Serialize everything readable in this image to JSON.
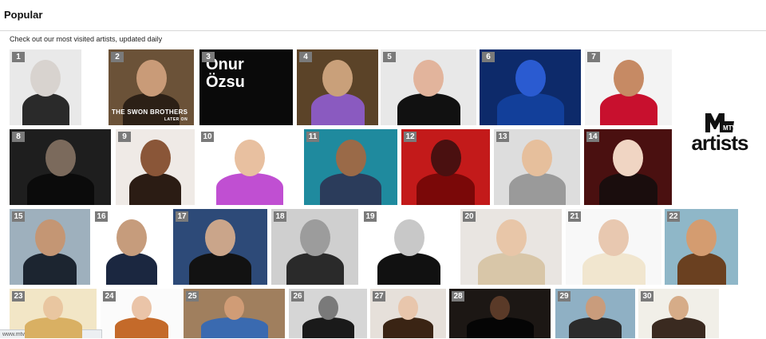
{
  "header": {
    "title": "Popular"
  },
  "subtitle": "Check out our most visited artists, updated daily",
  "brand": {
    "logo_text": "MTV",
    "word": "artists"
  },
  "status_bar": {
    "url": "www.mtv.com/artists/onur-ozsu/"
  },
  "tile_captions": {
    "onur": [
      "Onur",
      "Özsu"
    ],
    "swon": "THE SWON BROTHERS",
    "swon_sub": "LATER ON"
  },
  "artists": [
    {
      "rank": "1",
      "bg": "#e9e9e9",
      "figure": "#2a2a2a",
      "skin": "#d8d3cf"
    },
    {
      "rank": "2",
      "bg": "#6b5238",
      "figure": "#2c2016",
      "skin": "#c99b78"
    },
    {
      "rank": "3",
      "bg": "#0a0a0a",
      "figure": "#1b1b1b",
      "skin": "#1b1b1b"
    },
    {
      "rank": "4",
      "bg": "#5b4328",
      "figure": "#8a5ac0",
      "skin": "#c9a07a"
    },
    {
      "rank": "5",
      "bg": "#e8e8e8",
      "figure": "#111111",
      "skin": "#e2b49c"
    },
    {
      "rank": "6",
      "bg": "#0d2a6a",
      "figure": "#123f9a",
      "skin": "#2a5bd1"
    },
    {
      "rank": "7",
      "bg": "#f3f3f3",
      "figure": "#c8102e",
      "skin": "#c68a64"
    },
    {
      "rank": "8",
      "bg": "#1e1e1e",
      "figure": "#0b0b0b",
      "skin": "#7b6a5c"
    },
    {
      "rank": "9",
      "bg": "#efeae6",
      "figure": "#2b1c14",
      "skin": "#8a5638"
    },
    {
      "rank": "10",
      "bg": "#ffffff",
      "figure": "#c04fd2",
      "skin": "#e8c0a0"
    },
    {
      "rank": "11",
      "bg": "#1f8a9e",
      "figure": "#2b3c5b",
      "skin": "#9a6a48"
    },
    {
      "rank": "12",
      "bg": "#c31a1a",
      "figure": "#7a0808",
      "skin": "#4a1010"
    },
    {
      "rank": "13",
      "bg": "#dddddd",
      "figure": "#9a9a9a",
      "skin": "#e6bf9c"
    },
    {
      "rank": "14",
      "bg": "#4a1010",
      "figure": "#1a0d0d",
      "skin": "#f0d5c3"
    },
    {
      "rank": "15",
      "bg": "#9eb0bd",
      "figure": "#1c2530",
      "skin": "#c49674"
    },
    {
      "rank": "16",
      "bg": "#ffffff",
      "figure": "#1b2740",
      "skin": "#c69c7c"
    },
    {
      "rank": "17",
      "bg": "#2d4a78",
      "figure": "#121212",
      "skin": "#caa58a"
    },
    {
      "rank": "18",
      "bg": "#cfcfcf",
      "figure": "#2a2a2a",
      "skin": "#9c9c9c"
    },
    {
      "rank": "19",
      "bg": "#ffffff",
      "figure": "#111111",
      "skin": "#c8c8c8"
    },
    {
      "rank": "20",
      "bg": "#e9e5e1",
      "figure": "#d8c6a8",
      "skin": "#e8c6a8"
    },
    {
      "rank": "21",
      "bg": "#f8f8f8",
      "figure": "#f1e6cf",
      "skin": "#e8c8b0"
    },
    {
      "rank": "22",
      "bg": "#8fb7c8",
      "figure": "#6a4020",
      "skin": "#d49c70"
    },
    {
      "rank": "23",
      "bg": "#f2e6c6",
      "figure": "#d9b063",
      "skin": "#e9c6a0"
    },
    {
      "rank": "24",
      "bg": "#fbfbfb",
      "figure": "#c46a2a",
      "skin": "#eac4a8"
    },
    {
      "rank": "25",
      "bg": "#a07f5e",
      "figure": "#3a6ab0",
      "skin": "#d09c76"
    },
    {
      "rank": "26",
      "bg": "#d6d6d6",
      "figure": "#1a1a1a",
      "skin": "#7a7a7a"
    },
    {
      "rank": "27",
      "bg": "#e6e0da",
      "figure": "#3a2414",
      "skin": "#e8c6ac"
    },
    {
      "rank": "28",
      "bg": "#1c1714",
      "figure": "#050505",
      "skin": "#5a3a28"
    },
    {
      "rank": "29",
      "bg": "#8fb0c4",
      "figure": "#2b2b2b",
      "skin": "#c99c7c"
    },
    {
      "rank": "30",
      "bg": "#f1efe8",
      "figure": "#3a2a20",
      "skin": "#d6ac88"
    }
  ]
}
